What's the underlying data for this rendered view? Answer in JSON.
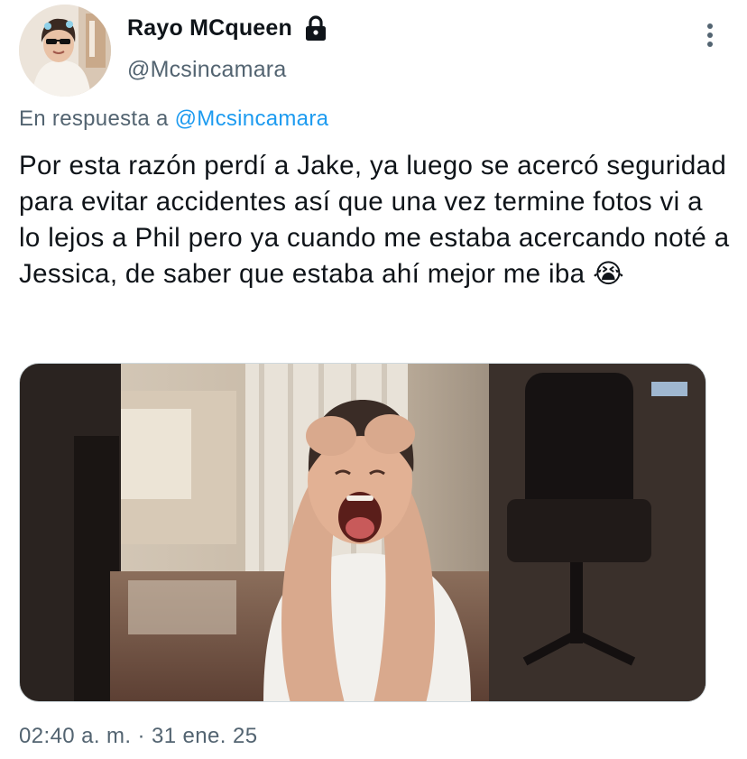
{
  "user": {
    "display_name": "Rayo MCqueen",
    "handle": "@Mcsincamara",
    "protected_icon": "lock-icon"
  },
  "reply": {
    "prefix": "En respuesta a",
    "mention": "@Mcsincamara"
  },
  "tweet": {
    "text": "Por esta razón perdí a Jake, ya luego se acercó seguridad para evitar accidentes así que una vez termine fotos vi a lo lejos a Phil pero ya cuando me estaba acercando noté a Jessica, de saber que estaba ahí mejor me iba",
    "emoji": "😭",
    "media_icon": "crying-kid-gif"
  },
  "meta": {
    "timestamp": "02:40 a. m. · 31 ene. 25"
  },
  "colors": {
    "text_primary": "#0f1419",
    "text_secondary": "#536471",
    "link": "#1d9bf0"
  }
}
